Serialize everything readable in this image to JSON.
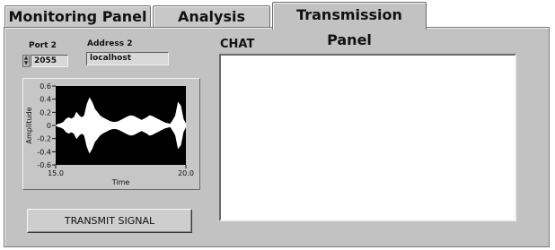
{
  "tabs": [
    {
      "label": "Monitoring Panel"
    },
    {
      "label": "Analysis Panel"
    },
    {
      "label": "Transmission Panel"
    }
  ],
  "active_tab": "Transmission Panel",
  "port": {
    "label": "Port 2",
    "value": "2055"
  },
  "address": {
    "label": "Address 2",
    "value": "localhost"
  },
  "chart": {
    "y_axis_label": "Amplitude",
    "x_axis_label": "Time",
    "y_ticks": [
      "0.6",
      "0.4",
      "0.2",
      "0",
      "-0.2",
      "-0.4",
      "-0.6"
    ],
    "x_ticks": [
      "15.0",
      "20.0"
    ]
  },
  "chart_data": {
    "type": "line",
    "xlabel": "Time",
    "ylabel": "Amplitude",
    "xlim": [
      15.0,
      20.0
    ],
    "ylim": [
      -0.6,
      0.6
    ],
    "series": [
      {
        "x": [
          15.0,
          15.1,
          15.2,
          15.3,
          15.4,
          15.5,
          15.6,
          15.7,
          15.8,
          15.9,
          16.0,
          16.1,
          16.2,
          16.3,
          16.4,
          16.5,
          16.6,
          16.7,
          16.8,
          16.9,
          17.0,
          17.1,
          17.2,
          17.3,
          17.4,
          17.5,
          17.6,
          17.7,
          17.8,
          17.9,
          18.0,
          18.1,
          18.2,
          18.3,
          18.4,
          18.5,
          18.6,
          18.7,
          18.8,
          18.9,
          19.0,
          19.1,
          19.2,
          19.3,
          19.4,
          19.5,
          19.6,
          19.7,
          19.8,
          19.9,
          20.0
        ],
        "y": [
          0.0,
          0.02,
          0.03,
          0.05,
          0.1,
          0.12,
          0.1,
          0.12,
          0.2,
          0.15,
          0.12,
          0.15,
          0.32,
          0.42,
          0.35,
          0.25,
          0.2,
          0.15,
          0.12,
          0.1,
          0.08,
          0.06,
          0.05,
          0.05,
          0.06,
          0.08,
          0.1,
          0.12,
          0.14,
          0.15,
          0.14,
          0.12,
          0.1,
          0.08,
          0.1,
          0.12,
          0.15,
          0.14,
          0.12,
          0.1,
          0.08,
          0.06,
          0.04,
          0.03,
          0.02,
          0.08,
          0.15,
          0.35,
          0.3,
          0.1,
          0.02
        ]
      }
    ]
  },
  "transmit_button": {
    "label": "TRANSMIT SIGNAL"
  },
  "chat": {
    "title": "CHAT"
  }
}
